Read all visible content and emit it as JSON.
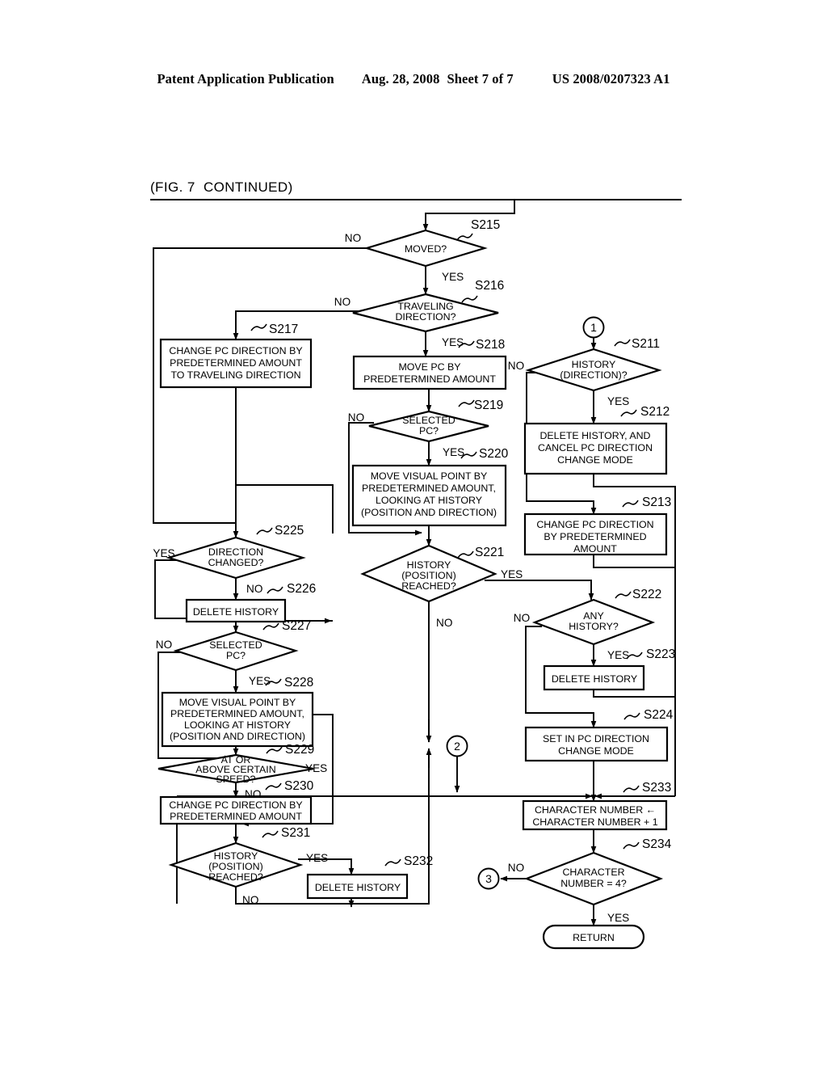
{
  "header": {
    "publication": "Patent Application Publication",
    "date": "Aug. 28, 2008",
    "sheet": "Sheet 7 of 7",
    "number": "US 2008/0207323 A1"
  },
  "figure": {
    "caption": "(FIG. 7  CONTINUED)"
  },
  "labels": {
    "yes": "YES",
    "no": "NO",
    "return": "RETURN",
    "conn1": "1",
    "conn2": "2",
    "conn3": "3"
  },
  "nodes": {
    "s215": {
      "step": "S215",
      "type": "decision",
      "text": [
        "MOVED?"
      ]
    },
    "s216": {
      "step": "S216",
      "type": "decision",
      "text": [
        "TRAVELING",
        "DIRECTION?"
      ]
    },
    "s217": {
      "step": "S217",
      "type": "process",
      "text": [
        "CHANGE PC DIRECTION BY",
        "PREDETERMINED AMOUNT",
        "TO TRAVELING DIRECTION"
      ]
    },
    "s218": {
      "step": "S218",
      "type": "process",
      "text": [
        "MOVE PC BY",
        "PREDETERMINED AMOUNT"
      ]
    },
    "s219": {
      "step": "S219",
      "type": "decision",
      "text": [
        "SELECTED",
        "PC?"
      ]
    },
    "s220": {
      "step": "S220",
      "type": "process",
      "text": [
        "MOVE VISUAL POINT BY",
        "PREDETERMINED AMOUNT,",
        "LOOKING AT HISTORY",
        "(POSITION AND DIRECTION)"
      ]
    },
    "s221": {
      "step": "S221",
      "type": "decision",
      "text": [
        "HISTORY",
        "(POSITION)",
        "REACHED?"
      ]
    },
    "s211": {
      "step": "S211",
      "type": "decision",
      "text": [
        "HISTORY",
        "(DIRECTION)?"
      ]
    },
    "s212": {
      "step": "S212",
      "type": "process",
      "text": [
        "DELETE HISTORY, AND",
        "CANCEL PC DIRECTION",
        "CHANGE MODE"
      ]
    },
    "s213": {
      "step": "S213",
      "type": "process",
      "text": [
        "CHANGE PC DIRECTION",
        "BY PREDETERMINED",
        "AMOUNT"
      ]
    },
    "s222": {
      "step": "S222",
      "type": "decision",
      "text": [
        "ANY",
        "HISTORY?"
      ]
    },
    "s223": {
      "step": "S223",
      "type": "process",
      "text": [
        "DELETE HISTORY"
      ]
    },
    "s224": {
      "step": "S224",
      "type": "process",
      "text": [
        "SET IN PC DIRECTION",
        "CHANGE MODE"
      ]
    },
    "s225": {
      "step": "S225",
      "type": "decision",
      "text": [
        "DIRECTION",
        "CHANGED?"
      ]
    },
    "s226": {
      "step": "S226",
      "type": "process",
      "text": [
        "DELETE HISTORY"
      ]
    },
    "s227": {
      "step": "S227",
      "type": "decision",
      "text": [
        "SELECTED",
        "PC?"
      ]
    },
    "s228": {
      "step": "S228",
      "type": "process",
      "text": [
        "MOVE VISUAL POINT BY",
        "PREDETERMINED AMOUNT,",
        "LOOKING AT HISTORY",
        "(POSITION AND DIRECTION)"
      ]
    },
    "s229": {
      "step": "S229",
      "type": "decision",
      "text": [
        "AT OR",
        "ABOVE CERTAIN",
        "SPEED?"
      ]
    },
    "s230": {
      "step": "S230",
      "type": "process",
      "text": [
        "CHANGE PC DIRECTION BY",
        "PREDETERMINED AMOUNT"
      ]
    },
    "s231": {
      "step": "S231",
      "type": "decision",
      "text": [
        "HISTORY",
        "(POSITION)",
        "REACHED?"
      ]
    },
    "s232": {
      "step": "S232",
      "type": "process",
      "text": [
        "DELETE HISTORY"
      ]
    },
    "s233": {
      "step": "S233",
      "type": "process",
      "text": [
        "CHARACTER NUMBER ←",
        "CHARACTER NUMBER + 1"
      ]
    },
    "s234": {
      "step": "S234",
      "type": "decision",
      "text": [
        "CHARACTER",
        "NUMBER = 4?"
      ]
    }
  },
  "colors": {
    "ink": "#000000",
    "paper": "#ffffff"
  }
}
